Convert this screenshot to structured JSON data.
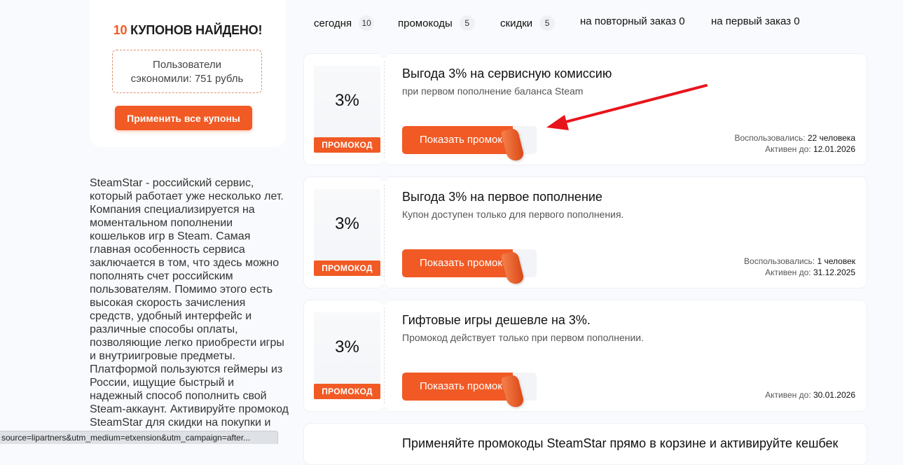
{
  "sidebar": {
    "found_count": "10",
    "found_text": "КУПОНОВ НАЙДЕНО!",
    "saved_line1": "Пользователи",
    "saved_line2": "сэкономили: 751 рубль",
    "apply_all_label": "Применить все купоны",
    "description": "SteamStar - российский сервис, который работает уже несколько лет. Компания специализируется на моментальном пополнении кошельков игр в Steam. Самая главная особенность сервиса заключается в том, что здесь можно пополнять счет российским пользователям. Помимо этого есть высокая скорость зачисления средств, удобный интерфейс и различные способы оплаты, позволяющие легко приобрести игры и внутриигровые предметы. Платформой пользуются геймеры из России, ищущие быстрый и надежный способ пополнить свой Steam-аккаунт. Активируйте промокод SteamStar для скидки на покупки и приятных бонусов!"
  },
  "tabs": [
    {
      "label": "сегодня",
      "count": "10"
    },
    {
      "label": "промокоды",
      "count": "5"
    },
    {
      "label": "скидки",
      "count": "5"
    },
    {
      "label": "на повторный заказ 0"
    },
    {
      "label": "на первый заказ 0"
    }
  ],
  "coupons": [
    {
      "value": "3%",
      "tag": "ПРОМОКОД",
      "title": "Выгода 3% на сервисную комиссию",
      "subtitle": "при первом пополнение баланса Steam",
      "button": "Показать промокод",
      "used_label": "Воспользовались:",
      "used_value": "22 человека",
      "active_label": "Активен до:",
      "active_value": "12.01.2026"
    },
    {
      "value": "3%",
      "tag": "ПРОМОКОД",
      "title": "Выгода 3% на первое пополнение",
      "subtitle": "Купон доступен только для первого пополнения.",
      "button": "Показать промокод",
      "used_label": "Воспользовались:",
      "used_value": "1 человек",
      "active_label": "Активен до:",
      "active_value": "31.12.2025"
    },
    {
      "value": "3%",
      "tag": "ПРОМОКОД",
      "title": "Гифтовые игры дешевле на 3%.",
      "subtitle": "Промокод действует только при первом пополнении.",
      "button": "Показать промокод",
      "active_label": "Активен до:",
      "active_value": "30.01.2026"
    },
    {
      "title": "Применяйте промокоды SteamStar прямо в корзине и активируйте кешбек"
    }
  ],
  "status_bar": "source=lipartners&utm_medium=etxension&utm_campaign=after...",
  "colors": {
    "accent": "#f15a24",
    "arrow": "#e8141c"
  }
}
